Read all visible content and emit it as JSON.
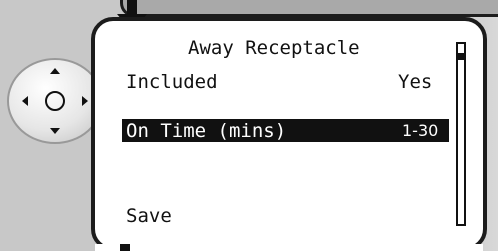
{
  "screen": {
    "title": "Away Receptacle",
    "rows": [
      {
        "label": "Included",
        "value": "Yes",
        "selected": false
      },
      {
        "label": "On Time (mins)",
        "value": "1-30",
        "selected": true
      }
    ],
    "action": "Save"
  },
  "scrollbar": {
    "position_fraction": 0.05
  },
  "colors": {
    "background": "#c8c8c8",
    "screen": "#ffffff",
    "border": "#1c1c1c",
    "selection": "#111111",
    "selection_text": "#ffffff"
  },
  "icons": {
    "top_arrow": "down-arrow-icon",
    "navigation": "directional-pad-icon"
  }
}
